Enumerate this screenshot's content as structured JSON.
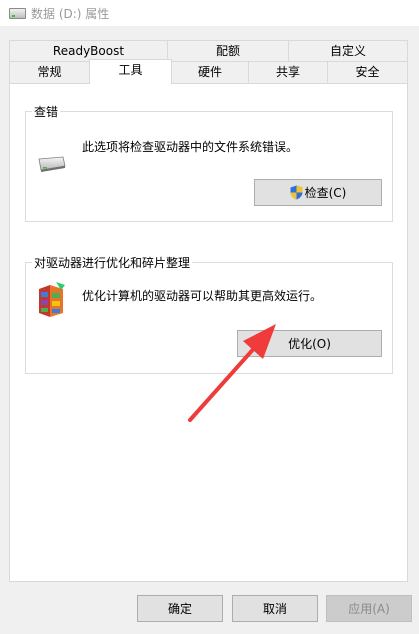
{
  "window": {
    "title": "数据 (D:) 属性"
  },
  "tabs": {
    "row_top": [
      {
        "label": "ReadyBoost"
      },
      {
        "label": "配额"
      },
      {
        "label": "自定义"
      }
    ],
    "row_bottom": [
      {
        "label": "常规"
      },
      {
        "label": "工具"
      },
      {
        "label": "硬件"
      },
      {
        "label": "共享"
      },
      {
        "label": "安全"
      }
    ],
    "active": "工具"
  },
  "error_check": {
    "title": "查错",
    "description": "此选项将检查驱动器中的文件系统错误。",
    "button_label": "检查(C)",
    "icon": "drive-icon"
  },
  "optimize": {
    "title": "对驱动器进行优化和碎片整理",
    "description": "优化计算机的驱动器可以帮助其更高效运行。",
    "button_label": "优化(O)",
    "icon": "defrag-icon"
  },
  "footer": {
    "ok_label": "确定",
    "cancel_label": "取消",
    "apply_label": "应用(A)"
  },
  "annotation": {
    "arrow_color": "#ef3b3b"
  }
}
